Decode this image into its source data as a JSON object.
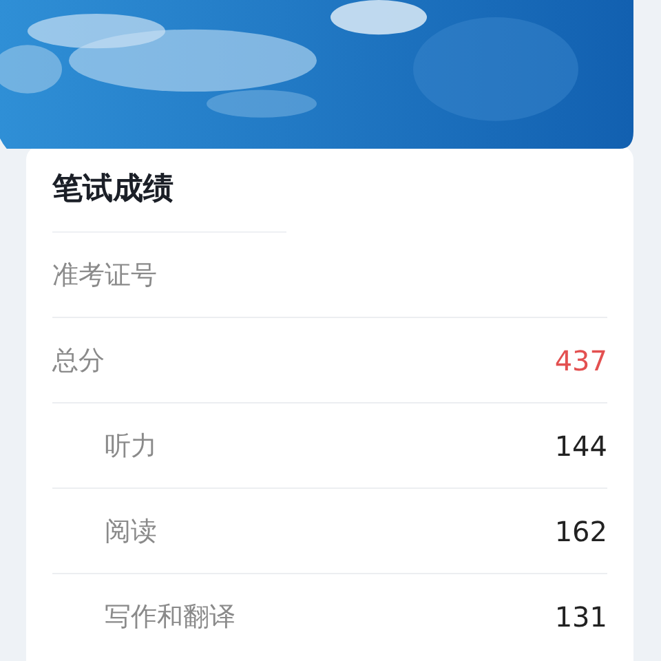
{
  "card": {
    "title": "笔试成绩",
    "rows": [
      {
        "label": "准考证号"
      },
      {
        "label": "总分",
        "value": "437",
        "highlight": true,
        "children": [
          {
            "label": "听力",
            "value": "144",
            "highlight": false
          },
          {
            "label": "阅读",
            "value": "162",
            "highlight": false
          },
          {
            "label": "写作和翻译",
            "value": "131",
            "highlight": false
          }
        ]
      }
    ]
  }
}
